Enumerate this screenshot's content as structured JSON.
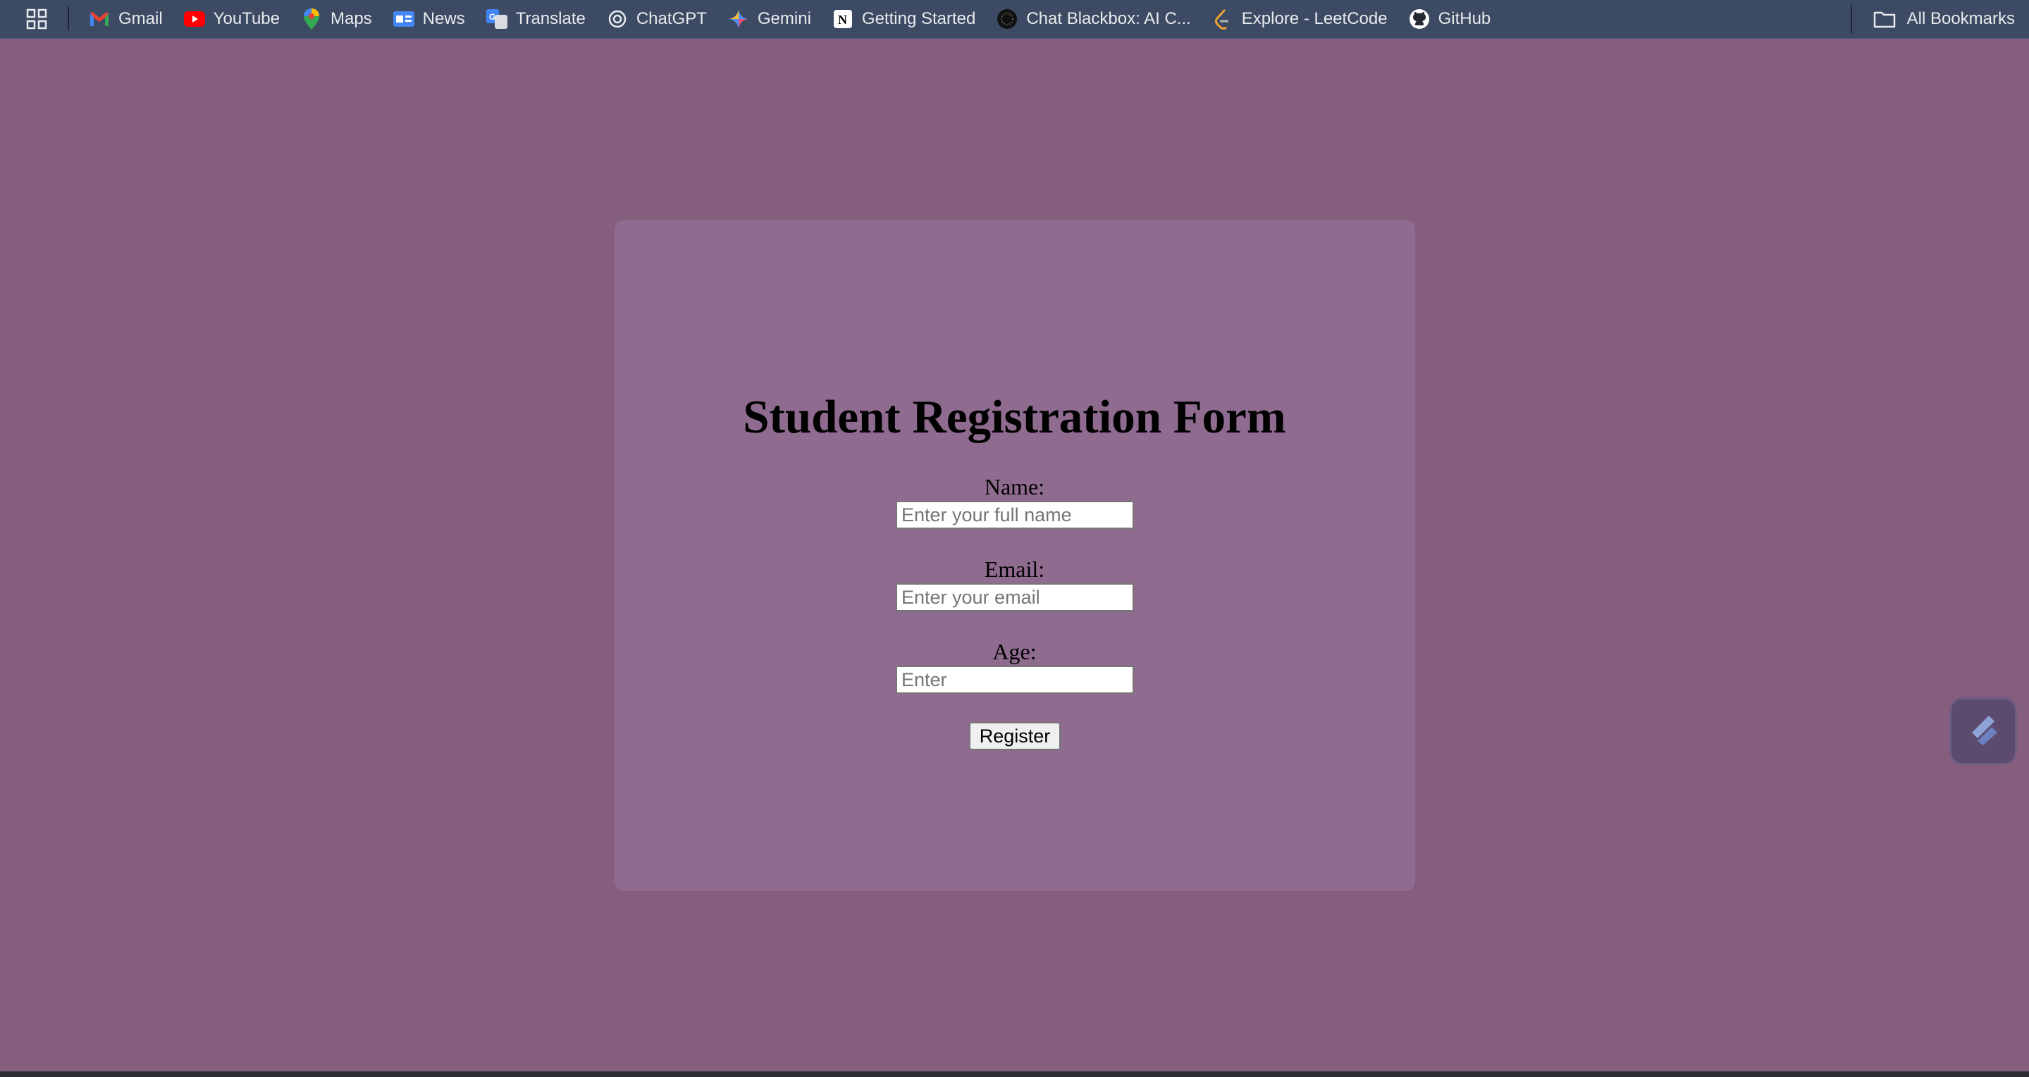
{
  "bookmarks_bar": {
    "items": [
      {
        "label": "Gmail",
        "icon": "gmail-icon"
      },
      {
        "label": "YouTube",
        "icon": "youtube-icon"
      },
      {
        "label": "Maps",
        "icon": "maps-icon"
      },
      {
        "label": "News",
        "icon": "news-icon"
      },
      {
        "label": "Translate",
        "icon": "translate-icon"
      },
      {
        "label": "ChatGPT",
        "icon": "chatgpt-icon"
      },
      {
        "label": "Gemini",
        "icon": "gemini-icon"
      },
      {
        "label": "Getting Started",
        "icon": "notion-icon"
      },
      {
        "label": "Chat Blackbox: AI C...",
        "icon": "blackbox-icon"
      },
      {
        "label": "Explore - LeetCode",
        "icon": "leetcode-icon"
      },
      {
        "label": "GitHub",
        "icon": "github-icon"
      }
    ],
    "all_bookmarks": "All Bookmarks"
  },
  "form": {
    "title": "Student Registration Form",
    "name_label": "Name:",
    "name_placeholder": "Enter your full name",
    "email_label": "Email:",
    "email_placeholder": "Enter your email",
    "age_label": "Age:",
    "age_placeholder": "Enter",
    "register_label": "Register"
  },
  "colors": {
    "page_background": "#845e7c",
    "card_background": "#8e6b8f",
    "bookmarks_bar": "#3c4b63"
  }
}
